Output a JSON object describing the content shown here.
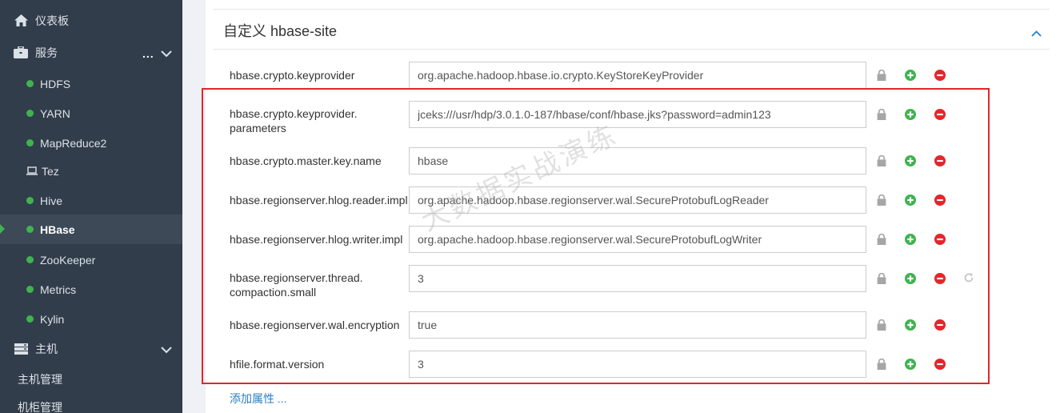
{
  "sidebar": {
    "dashboard_label": "仪表板",
    "services_label": "服务",
    "services_menu": "...",
    "services": [
      {
        "label": "HDFS",
        "status": "green"
      },
      {
        "label": "YARN",
        "status": "green"
      },
      {
        "label": "MapReduce2",
        "status": "green"
      },
      {
        "label": "Tez",
        "status": "client"
      },
      {
        "label": "Hive",
        "status": "green"
      },
      {
        "label": "HBase",
        "status": "green",
        "active": true
      },
      {
        "label": "ZooKeeper",
        "status": "green"
      },
      {
        "label": "Metrics",
        "status": "green"
      },
      {
        "label": "Kylin",
        "status": "green"
      }
    ],
    "hosts_label": "主机",
    "host_management_label": "主机管理",
    "rack_management_label": "机柜管理"
  },
  "section": {
    "title": "自定义 hbase-site",
    "add_property_label": "添加属性 ..."
  },
  "properties": [
    {
      "name": "hbase.crypto.keyprovider",
      "value": "org.apache.hadoop.hbase.io.crypto.KeyStoreKeyProvider"
    },
    {
      "name": "hbase.crypto.keyprovider.\nparameters",
      "value": "jceks:///usr/hdp/3.0.1.0-187/hbase/conf/hbase.jks?password=admin123"
    },
    {
      "name": "hbase.crypto.master.key.name",
      "value": "hbase"
    },
    {
      "name": "hbase.regionserver.hlog.reader.impl",
      "value": "org.apache.hadoop.hbase.regionserver.wal.SecureProtobufLogReader"
    },
    {
      "name": "hbase.regionserver.hlog.writer.impl",
      "value": "org.apache.hadoop.hbase.regionserver.wal.SecureProtobufLogWriter"
    },
    {
      "name": "hbase.regionserver.thread.\ncompaction.small",
      "value": "3",
      "show_undo": true
    },
    {
      "name": "hbase.regionserver.wal.encryption",
      "value": "true"
    },
    {
      "name": "hfile.format.version",
      "value": "3"
    }
  ],
  "watermark": "大数据实战演练",
  "colors": {
    "sidebar_bg": "#323d4b",
    "status_green": "#3fb34f",
    "add_green": "#3fb34f",
    "remove_red": "#e3262b",
    "highlight_red": "#e3262b",
    "link_blue": "#2a7fc3"
  }
}
